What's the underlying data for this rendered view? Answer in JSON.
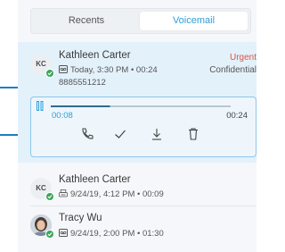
{
  "tabs": {
    "recents_label": "Recents",
    "voicemail_label": "Voicemail",
    "active": "Voicemail"
  },
  "voicemails": [
    {
      "initials": "KC",
      "name": "Kathleen Carter",
      "meta": "Today, 3:30 PM • 00:24",
      "number": "8885551212",
      "tag_urgent": "Urgent",
      "tag_confidential": "Confidential",
      "presence": "online"
    },
    {
      "initials": "KC",
      "name": "Kathleen Carter",
      "meta": "9/24/19, 4:12 PM • 00:09",
      "presence": "online"
    },
    {
      "initials": "",
      "name": "Tracy Wu",
      "meta": "9/24/19, 2:00 PM • 01:30",
      "presence": "online"
    }
  ],
  "player": {
    "current_time": "00:08",
    "duration": "00:24",
    "progress": 0.33,
    "pause_icon": "pause-icon",
    "actions": [
      "call-back-icon",
      "mark-read-check-icon",
      "download-icon",
      "delete-trash-icon"
    ]
  },
  "colors": {
    "accent": "#2f9fd8",
    "selected_bg": "#e3f1fb",
    "urgent": "#e0533f",
    "presence_online": "#3aa657",
    "callout": "#1b7fc4"
  }
}
